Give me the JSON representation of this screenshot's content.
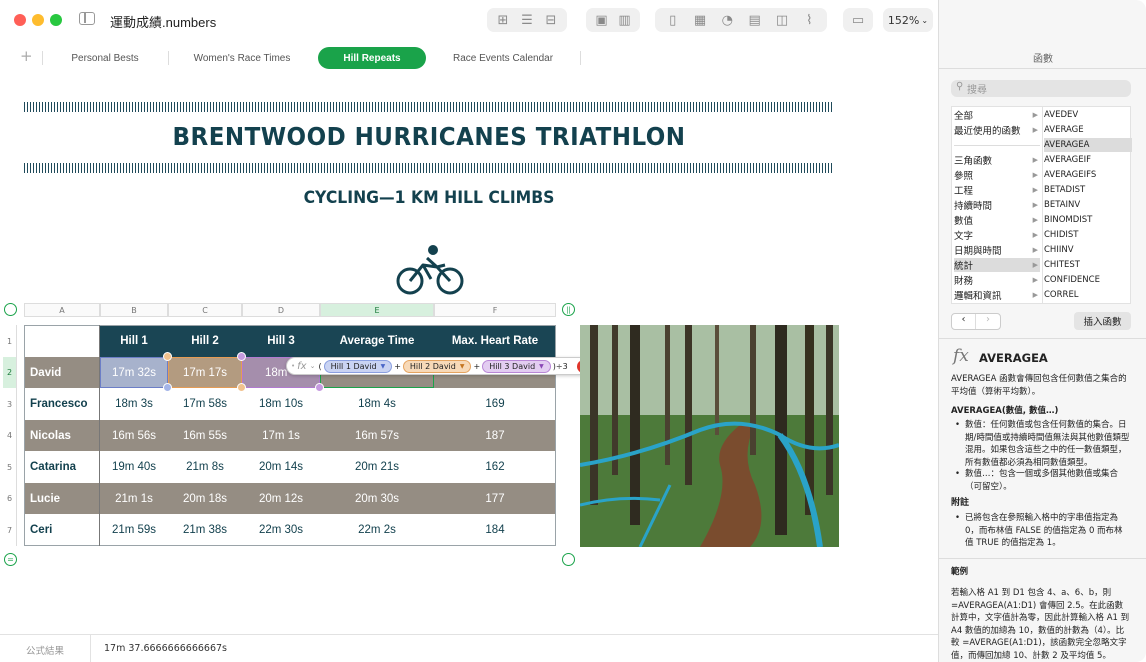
{
  "app": {
    "filename": "運動成績.numbers",
    "zoom": "152%"
  },
  "tabs": [
    "Personal Bests",
    "Women's Race Times",
    "Hill Repeats",
    "Race Events Calendar"
  ],
  "doc": {
    "title": "BRENTWOOD HURRICANES TRIATHLON",
    "subtitle": "CYCLING—1 KM HILL CLIMBS"
  },
  "columns": [
    "A",
    "B",
    "C",
    "D",
    "E",
    "F"
  ],
  "rows": [
    "1",
    "2",
    "3",
    "4",
    "5",
    "6",
    "7"
  ],
  "table": {
    "headers": [
      "Hill 1",
      "Hill 2",
      "Hill 3",
      "Average Time",
      "Max. Heart Rate"
    ],
    "data": [
      [
        "David",
        "17m 32s",
        "17m 17s",
        "18m",
        "",
        ""
      ],
      [
        "Francesco",
        "18m 3s",
        "17m 58s",
        "18m 10s",
        "18m 4s",
        "169"
      ],
      [
        "Nicolas",
        "16m 56s",
        "16m 55s",
        "17m 1s",
        "16m 57s",
        "187"
      ],
      [
        "Catarina",
        "19m 40s",
        "21m 8s",
        "20m 14s",
        "20m 21s",
        "162"
      ],
      [
        "Lucie",
        "21m 1s",
        "20m 18s",
        "20m 12s",
        "20m 30s",
        "177"
      ],
      [
        "Ceri",
        "21m 59s",
        "21m 38s",
        "22m 30s",
        "22m 2s",
        "184"
      ]
    ]
  },
  "formula": {
    "fx": "fx",
    "open": "(",
    "t1": "Hill 1 David",
    "t2": "Hill 2 David",
    "t3": "Hill 3 David",
    "plus": "+",
    "tail": ")÷3"
  },
  "sidebar": {
    "title": "函數",
    "search_placeholder": "搜尋",
    "categories": [
      "全部",
      "最近使用的函數",
      "",
      "三角函數",
      "參照",
      "工程",
      "持續時間",
      "數值",
      "文字",
      "日期與時間",
      "統計",
      "財務",
      "邏輯和資訊"
    ],
    "functions": [
      "AVEDEV",
      "AVERAGE",
      "AVERAGEA",
      "AVERAGEIF",
      "AVERAGEIFS",
      "BETADIST",
      "BETAINV",
      "BINOMDIST",
      "CHIDIST",
      "CHIINV",
      "CHITEST",
      "CONFIDENCE",
      "CORREL"
    ],
    "insert_button": "插入函數",
    "fx_name": "AVERAGEA",
    "desc": "AVERAGEA 函數會傳回包含任何數值之集合的平均值（算術平均數）。",
    "syntax": "AVERAGEA(數值, 數值…)",
    "arg1": "數值：任何數值或包含任何數值的集合。日期/時間值或持續時間值無法與其他數值類型混用。如果包含這些之中的任一數值類型，所有數值都必須為相同數值類型。",
    "arg2": "數值…：包含一個或多個其他數值或集合（可留空）。",
    "notes_title": "附註",
    "note1": "已將包含在參照輸入格中的字串值指定為 0，而布林值 FALSE 的值指定為 0 而布林值 TRUE 的值指定為 1。",
    "example_title": "範例",
    "example": "若輸入格 A1 到 D1 包含 4、a、6、b，則 =AVERAGEA(A1:D1) 會傳回 2.5。在此函數計算中，文字值計為零，因此計算輸入格 A1 到 A4 數值的加總為 10，數值的計數為（4）。比較 =AVERAGE(A1:D1)，該函數完全忽略文字值，而傳回加總 10、計數 2 及平均值 5。"
  },
  "status": {
    "label": "公式結果",
    "value": "17m 37.6666666666667s"
  },
  "colors": {
    "accent": "#1aa34a",
    "header": "#1a4554",
    "grey_row": "#958d83",
    "title": "#13414e"
  }
}
